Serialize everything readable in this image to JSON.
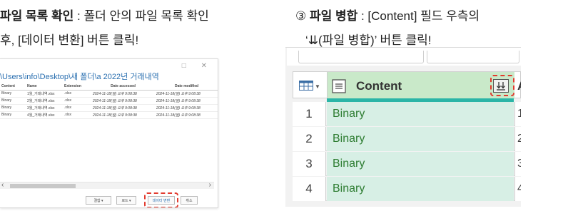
{
  "captions": {
    "left_line1_bold": "파일 목록 확인",
    "left_line1_rest": " :  폴더 안의 파일 목록 확인",
    "left_line2": "후, [데이터 변환] 버튼 클릭!",
    "right_line1_num": "③ ",
    "right_line1_bold": "파일 병합",
    "right_line1_rest": " : [Content] 필드 우측의",
    "right_line2": "‘⇊(파일 병합)’ 버튼 클릭!"
  },
  "dialog": {
    "path": "\\Users\\info\\Desktop\\새 폴더\\a 2022년 거래내역",
    "window_buttons": "□ ✕",
    "columns": [
      "Content",
      "Name",
      "Extension",
      "Date accessed",
      "Date modified"
    ],
    "rows": [
      [
        "Binary",
        "1월_거래내역.xlsx",
        ".xlsx",
        "2024-11-18(월) 오후 9:08:38",
        "2024-11-18(월) 오후 9:08:38"
      ],
      [
        "Binary",
        "2월_거래내역.xlsx",
        ".xlsx",
        "2024-11-18(월) 오후 9:08:38",
        "2024-11-18(월) 오후 9:08:38"
      ],
      [
        "Binary",
        "3월_거래내역.xlsx",
        ".xlsx",
        "2024-11-18(월) 오후 9:08:38",
        "2024-11-18(월) 오후 9:08:38"
      ],
      [
        "Binary",
        "4월_거래내역.xlsx",
        ".xlsx",
        "2024-11-18(월) 오후 9:08:38",
        "2024-11-18(월) 오후 9:08:38"
      ]
    ],
    "buttons": {
      "combine": "결합 ▾",
      "load": "로드 ▾",
      "transform": "데이터 변환",
      "cancel": "취소"
    }
  },
  "query": {
    "column_name": "Content",
    "next_column_initial": "A",
    "rows": [
      {
        "num": "1",
        "value": "Binary",
        "next": "1"
      },
      {
        "num": "2",
        "value": "Binary",
        "next": "2"
      },
      {
        "num": "3",
        "value": "Binary",
        "next": "3"
      },
      {
        "num": "4",
        "value": "Binary",
        "next": "4"
      }
    ]
  }
}
